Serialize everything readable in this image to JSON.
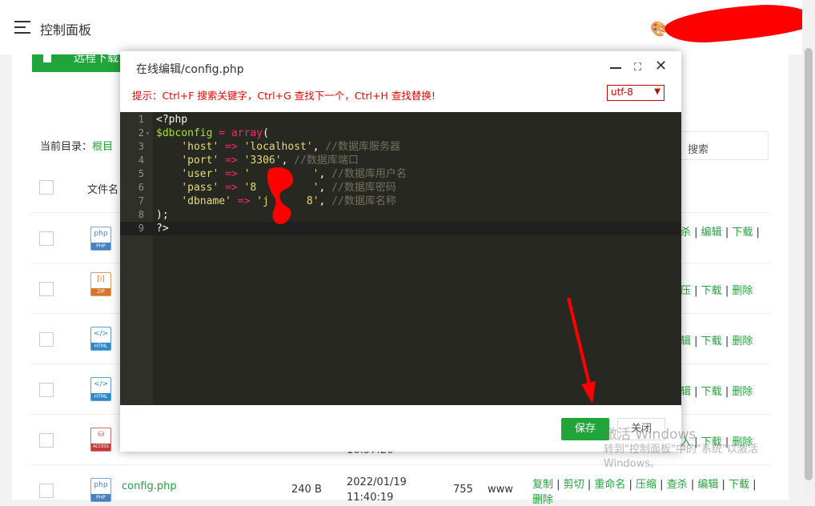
{
  "header": {
    "title": "控制面板",
    "menu_icon": "hamburger-icon",
    "theme_icon": "palette-icon"
  },
  "toolbar": {
    "remote_download": "远程下载"
  },
  "browser": {
    "current_dir_label": "当前目录：",
    "current_dir_value": "根目",
    "search_label": "搜索",
    "col_filename": "文件名"
  },
  "rows": [
    {
      "ext": "PHP",
      "ops": [
        "杀",
        "编辑",
        "下载"
      ]
    },
    {
      "ext": "ZIP",
      "ops": [
        "压",
        "下载",
        "删除"
      ]
    },
    {
      "ext": "HTML",
      "ops": [
        "辑",
        "下载",
        "删除"
      ]
    },
    {
      "ext": "HTML",
      "ops": [
        "辑",
        "下载",
        "删除"
      ]
    },
    {
      "ext": "ACCESS",
      "ops": [
        "入",
        "下载",
        "删除"
      ],
      "time_partial": "10:57:26"
    },
    {
      "ext": "PHP",
      "name": "config.php",
      "size": "240 B",
      "date": "2022/01/19",
      "time": "11:40:19",
      "perm": "755",
      "owner": "www",
      "ops": [
        "复制",
        "剪切",
        "重命名",
        "压缩",
        "查杀",
        "编辑",
        "下载"
      ],
      "ops_line2": "删除"
    }
  ],
  "editor": {
    "title": "在线编辑/config.php",
    "tip": "提示：Ctrl+F 搜索关键字，Ctrl+G 查找下一个，Ctrl+H 查找替换!",
    "encoding": "utf-8",
    "save": "保存",
    "cancel": "关闭",
    "code": [
      {
        "n": "1",
        "fold": "",
        "parts": [
          [
            "k-tag",
            "<?php"
          ]
        ]
      },
      {
        "n": "2",
        "fold": "▾",
        "parts": [
          [
            "k-var",
            "$dbconfig"
          ],
          [
            "k-tag",
            " "
          ],
          [
            "k-op",
            "="
          ],
          [
            "k-tag",
            " "
          ],
          [
            "k-op",
            "array"
          ],
          [
            "k-tag",
            "("
          ]
        ]
      },
      {
        "n": "3",
        "fold": "",
        "parts": [
          [
            "k-tag",
            "    "
          ],
          [
            "k-str",
            "'host'"
          ],
          [
            "k-tag",
            " "
          ],
          [
            "k-op",
            "=>"
          ],
          [
            "k-tag",
            " "
          ],
          [
            "k-str",
            "'localhost'"
          ],
          [
            "k-tag",
            ", "
          ],
          [
            "k-cm",
            "//数据库服务器"
          ]
        ]
      },
      {
        "n": "4",
        "fold": "",
        "parts": [
          [
            "k-tag",
            "    "
          ],
          [
            "k-str",
            "'port'"
          ],
          [
            "k-tag",
            " "
          ],
          [
            "k-op",
            "=>"
          ],
          [
            "k-tag",
            " "
          ],
          [
            "k-str",
            "'3306'"
          ],
          [
            "k-tag",
            ", "
          ],
          [
            "k-cm",
            "//数据库端口"
          ]
        ]
      },
      {
        "n": "5",
        "fold": "",
        "parts": [
          [
            "k-tag",
            "    "
          ],
          [
            "k-str",
            "'user'"
          ],
          [
            "k-tag",
            " "
          ],
          [
            "k-op",
            "=>"
          ],
          [
            "k-tag",
            " "
          ],
          [
            "k-str",
            "'          '"
          ],
          [
            "k-tag",
            ", "
          ],
          [
            "k-cm",
            "//数据库用户名"
          ]
        ]
      },
      {
        "n": "6",
        "fold": "",
        "parts": [
          [
            "k-tag",
            "    "
          ],
          [
            "k-str",
            "'pass'"
          ],
          [
            "k-tag",
            " "
          ],
          [
            "k-op",
            "=>"
          ],
          [
            "k-tag",
            " "
          ],
          [
            "k-str",
            "'8         '"
          ],
          [
            "k-tag",
            ", "
          ],
          [
            "k-cm",
            "//数据库密码"
          ]
        ]
      },
      {
        "n": "7",
        "fold": "",
        "parts": [
          [
            "k-tag",
            "    "
          ],
          [
            "k-str",
            "'dbname'"
          ],
          [
            "k-tag",
            " "
          ],
          [
            "k-op",
            "=>"
          ],
          [
            "k-tag",
            " "
          ],
          [
            "k-str",
            "'j      8'"
          ],
          [
            "k-tag",
            ", "
          ],
          [
            "k-cm",
            "//数据库名称"
          ]
        ]
      },
      {
        "n": "8",
        "fold": "",
        "parts": [
          [
            "k-tag",
            ");"
          ]
        ]
      },
      {
        "n": "9",
        "fold": "",
        "parts": [
          [
            "k-tag",
            "?>"
          ]
        ]
      }
    ]
  },
  "watermark": {
    "line1": "激活 Windows",
    "line2": "转到\"控制面板\"中的\"系统\"以激活",
    "line3": "Windows。"
  },
  "colors": {
    "accent": "#20a53a",
    "tip": "#ee0000",
    "editor_bg": "#272822"
  }
}
